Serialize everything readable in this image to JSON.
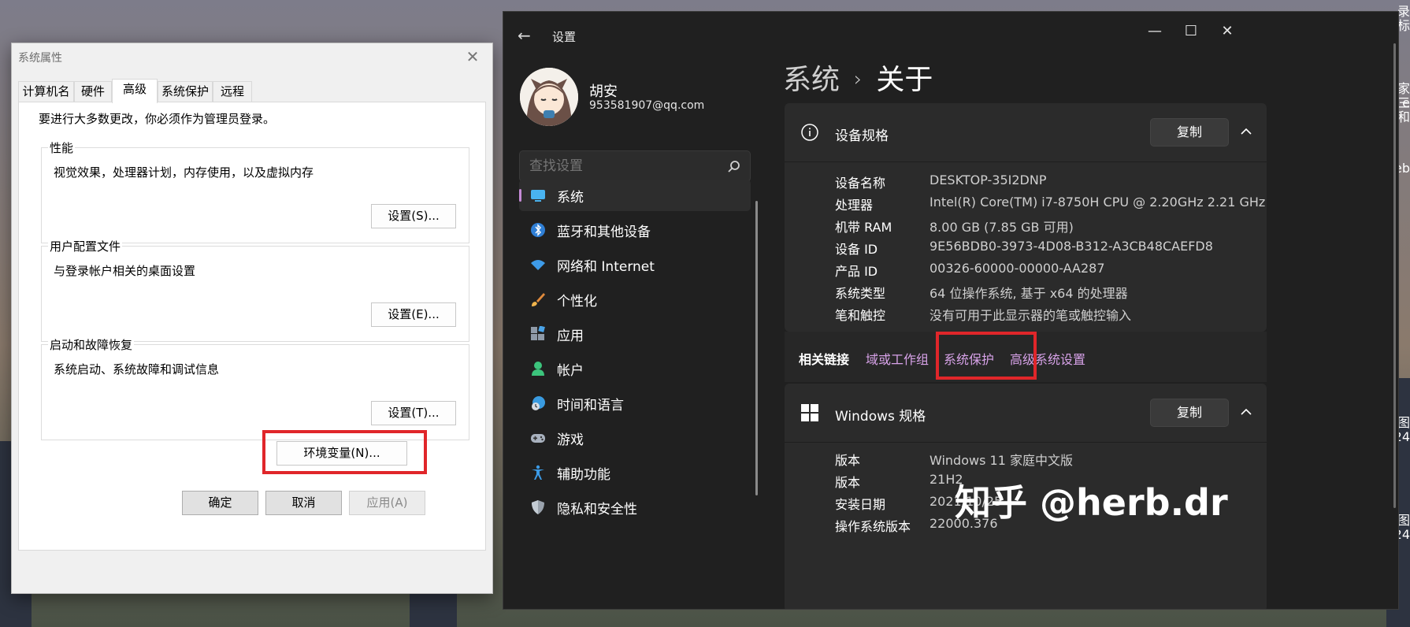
{
  "dialog": {
    "title": "系统属性",
    "tabs": [
      "计算机名",
      "硬件",
      "高级",
      "系统保护",
      "远程"
    ],
    "active_tab": "高级",
    "admin_note": "要进行大多数更改，你必须作为管理员登录。",
    "groups": [
      {
        "label": "性能",
        "desc": "视觉效果，处理器计划，内存使用，以及虚拟内存",
        "button": "设置(S)..."
      },
      {
        "label": "用户配置文件",
        "desc": "与登录帐户相关的桌面设置",
        "button": "设置(E)..."
      },
      {
        "label": "启动和故障恢复",
        "desc": "系统启动、系统故障和调试信息",
        "button": "设置(T)..."
      }
    ],
    "env_button": "环境变量(N)...",
    "ok": "确定",
    "cancel": "取消",
    "apply": "应用(A)"
  },
  "settings": {
    "title": "设置",
    "user": {
      "name": "胡安",
      "email": "953581907@qq.com"
    },
    "search_placeholder": "查找设置",
    "nav": [
      {
        "label": "系统",
        "icon": "monitor-icon",
        "active": true
      },
      {
        "label": "蓝牙和其他设备",
        "icon": "bluetooth-icon"
      },
      {
        "label": "网络和 Internet",
        "icon": "wifi-icon"
      },
      {
        "label": "个性化",
        "icon": "brush-icon"
      },
      {
        "label": "应用",
        "icon": "apps-icon"
      },
      {
        "label": "帐户",
        "icon": "person-icon"
      },
      {
        "label": "时间和语言",
        "icon": "globe-clock-icon"
      },
      {
        "label": "游戏",
        "icon": "gamepad-icon"
      },
      {
        "label": "辅助功能",
        "icon": "accessibility-icon"
      },
      {
        "label": "隐私和安全性",
        "icon": "shield-icon"
      }
    ],
    "breadcrumb": {
      "parent": "系统",
      "separator": "›",
      "current": "关于"
    },
    "device_card": {
      "title": "设备规格",
      "copy": "复制",
      "rows": [
        {
          "k": "设备名称",
          "v": "DESKTOP-35I2DNP"
        },
        {
          "k": "处理器",
          "v": "Intel(R) Core(TM) i7-8750H CPU @ 2.20GHz   2.21 GHz"
        },
        {
          "k": "机带 RAM",
          "v": "8.00 GB (7.85 GB 可用)"
        },
        {
          "k": "设备 ID",
          "v": "9E56BDB0-3973-4D08-B312-A3CB48CAEFD8"
        },
        {
          "k": "产品 ID",
          "v": "00326-60000-00000-AA287"
        },
        {
          "k": "系统类型",
          "v": "64 位操作系统, 基于 x64 的处理器"
        },
        {
          "k": "笔和触控",
          "v": "没有可用于此显示器的笔或触控输入"
        }
      ]
    },
    "related": {
      "label": "相关链接",
      "links": [
        "域或工作组",
        "系统保护",
        "高级系统设置"
      ]
    },
    "windows_card": {
      "title": "Windows 规格",
      "copy": "复制",
      "rows": [
        {
          "k": "版本",
          "v": "Windows 11 家庭中文版"
        },
        {
          "k": "版本",
          "v": "21H2"
        },
        {
          "k": "安装日期",
          "v": "2021/10/25"
        },
        {
          "k": "操作系统版本",
          "v": "22000.376"
        }
      ]
    }
  },
  "watermark": "知乎 @herb.dr",
  "desktop_edge_text": [
    "录标",
    "家三",
    "e 和",
    "eb",
    "l图",
    "24",
    "l图",
    "24"
  ],
  "colors": {
    "highlight_red": "#e0262a",
    "link_purple": "#d7a2e8",
    "nav_accent": "#c58ad6"
  }
}
